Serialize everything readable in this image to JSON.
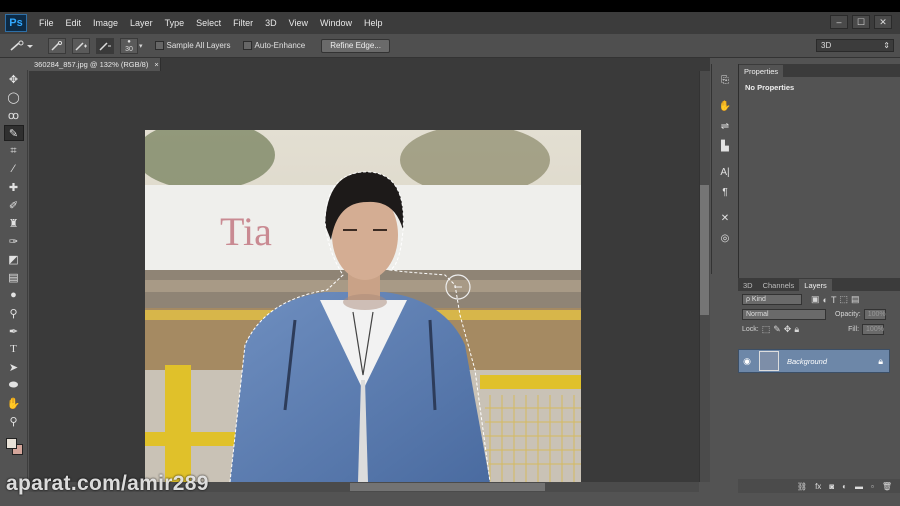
{
  "app": {
    "logo": "Ps"
  },
  "menu": [
    "File",
    "Edit",
    "Image",
    "Layer",
    "Type",
    "Select",
    "Filter",
    "3D",
    "View",
    "Window",
    "Help"
  ],
  "window_controls": [
    "–",
    "☐",
    "✕"
  ],
  "options": {
    "brush_size": "30",
    "sample_all_layers": "Sample All Layers",
    "auto_enhance": "Auto-Enhance",
    "refine_edge": "Refine Edge...",
    "workspace": "3D"
  },
  "document": {
    "tab_title": "360284_857.jpg @ 132% (RGB/8)",
    "close": "×",
    "sign_text_left": "Tia"
  },
  "properties": {
    "tab": "Properties",
    "body": "No Properties"
  },
  "layers": {
    "tabs": [
      "3D",
      "Channels",
      "Layers"
    ],
    "kind_label": "ρ Kind",
    "blend_mode": "Normal",
    "opacity_label": "Opacity:",
    "opacity_value": "100%",
    "lock_label": "Lock:",
    "fill_label": "Fill:",
    "fill_value": "100%",
    "layer_name": "Background"
  },
  "watermark": "aparat.com/amir289",
  "colors": {
    "accent": "#31a8ff",
    "selected_layer": "#6d87a8",
    "foreground": "#e9e2d8",
    "background": "#d4a59a"
  },
  "icons": {
    "tools": [
      "move-icon",
      "marquee-icon",
      "lasso-icon",
      "quick-selection-icon",
      "crop-icon",
      "eyedropper-icon",
      "spot-heal-icon",
      "brush-icon",
      "clone-stamp-icon",
      "history-brush-icon",
      "eraser-icon",
      "gradient-icon",
      "blur-icon",
      "dodge-icon",
      "pen-icon",
      "type-icon",
      "path-select-icon",
      "shape-icon",
      "hand-icon",
      "zoom-icon"
    ],
    "strip": [
      "history-icon",
      "actions-icon",
      "adjustments-icon",
      "styles-icon",
      "character-icon",
      "paragraph-icon",
      "tool-presets-icon",
      "clone-source-icon"
    ]
  }
}
